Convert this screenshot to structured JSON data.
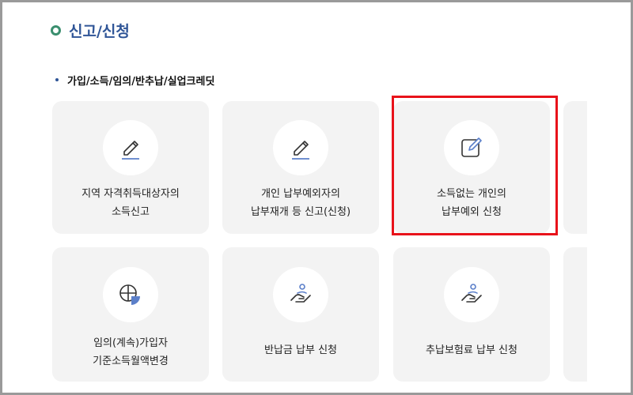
{
  "page": {
    "title": "신고/신청"
  },
  "section": {
    "title": "가입/소득/임의/반추납/실업크레딧"
  },
  "cards": [
    {
      "line1": "지역 자격취득대상자의",
      "line2": "소득신고",
      "icon": "pencil-icon"
    },
    {
      "line1": "개인 납부예외자의",
      "line2": "납부재개 등 신고(신청)",
      "icon": "pencil-icon"
    },
    {
      "line1": "소득없는 개인의",
      "line2": "납부예외 신청",
      "icon": "edit-square-icon",
      "highlighted": true
    },
    {
      "line1": "임의(계속)가입자",
      "line2": "기준소득월액변경",
      "icon": "pie-chart-icon"
    },
    {
      "line1": "반납금 납부 신청",
      "icon": "hand-person-icon"
    },
    {
      "line1": "추납보험료 납부 신청",
      "icon": "hand-person-icon"
    }
  ],
  "colors": {
    "title": "#2f5597",
    "title_bullet": "#3a8e6e",
    "card_background": "#f3f3f3",
    "icon_stroke": "#333333",
    "icon_accent": "#5b7fc9",
    "highlight_border": "#e8121a"
  }
}
